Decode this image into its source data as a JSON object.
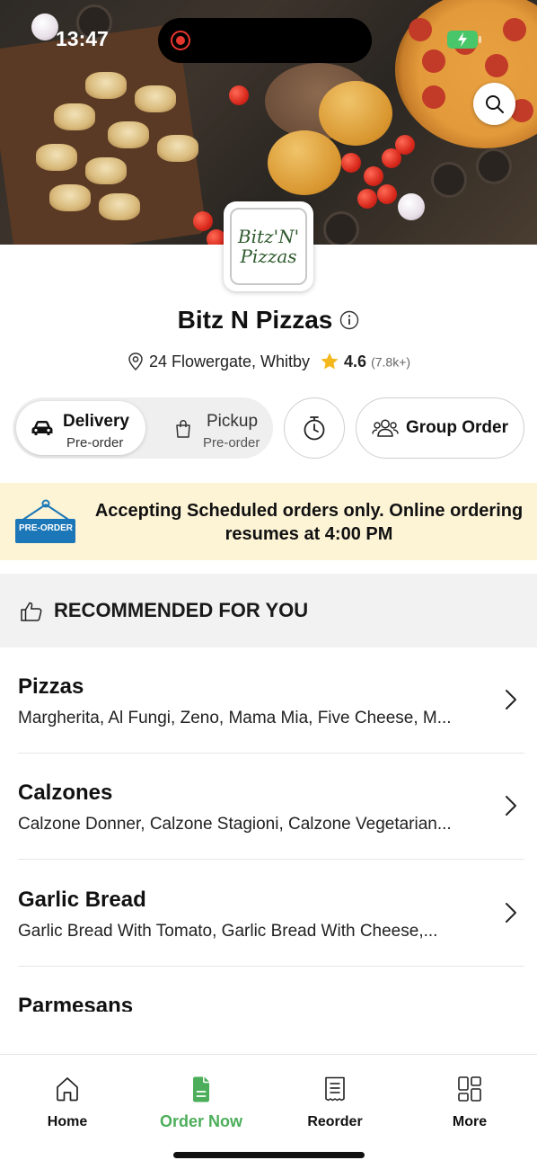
{
  "status_bar": {
    "time": "13:47"
  },
  "header": {
    "search_icon": "search-icon"
  },
  "store": {
    "logo_line1": "Bitz'N'",
    "logo_line2": "Pizzas",
    "name": "Bitz N Pizzas",
    "address": "24 Flowergate, Whitby",
    "rating": "4.6",
    "reviews": "(7.8k+)"
  },
  "modes": {
    "delivery": {
      "title": "Delivery",
      "sub": "Pre-order"
    },
    "pickup": {
      "title": "Pickup",
      "sub": "Pre-order"
    },
    "group_order": "Group Order"
  },
  "banner": {
    "sign_text": "PRE-ORDER",
    "text": "Accepting Scheduled orders only. Online ordering resumes at 4:00 PM"
  },
  "recommended": {
    "title": "RECOMMENDED FOR YOU"
  },
  "categories": [
    {
      "name": "Pizzas",
      "items": "Margherita, Al Fungi, Zeno, Mama Mia, Five Cheese, M..."
    },
    {
      "name": "Calzones",
      "items": "Calzone Donner, Calzone Stagioni, Calzone Vegetarian..."
    },
    {
      "name": "Garlic Bread",
      "items": "Garlic Bread With Tomato, Garlic Bread With Cheese,..."
    },
    {
      "name": "Parmesans",
      "items": ""
    }
  ],
  "bottom_nav": [
    {
      "label": "Home",
      "icon": "home-icon"
    },
    {
      "label": "Order Now",
      "icon": "order-icon",
      "active": true
    },
    {
      "label": "Reorder",
      "icon": "receipt-icon"
    },
    {
      "label": "More",
      "icon": "grid-icon"
    }
  ],
  "colors": {
    "accent": "#4cae5a",
    "banner_bg": "#fdf4d6",
    "star": "#f5b81c",
    "record": "#e5372e"
  }
}
